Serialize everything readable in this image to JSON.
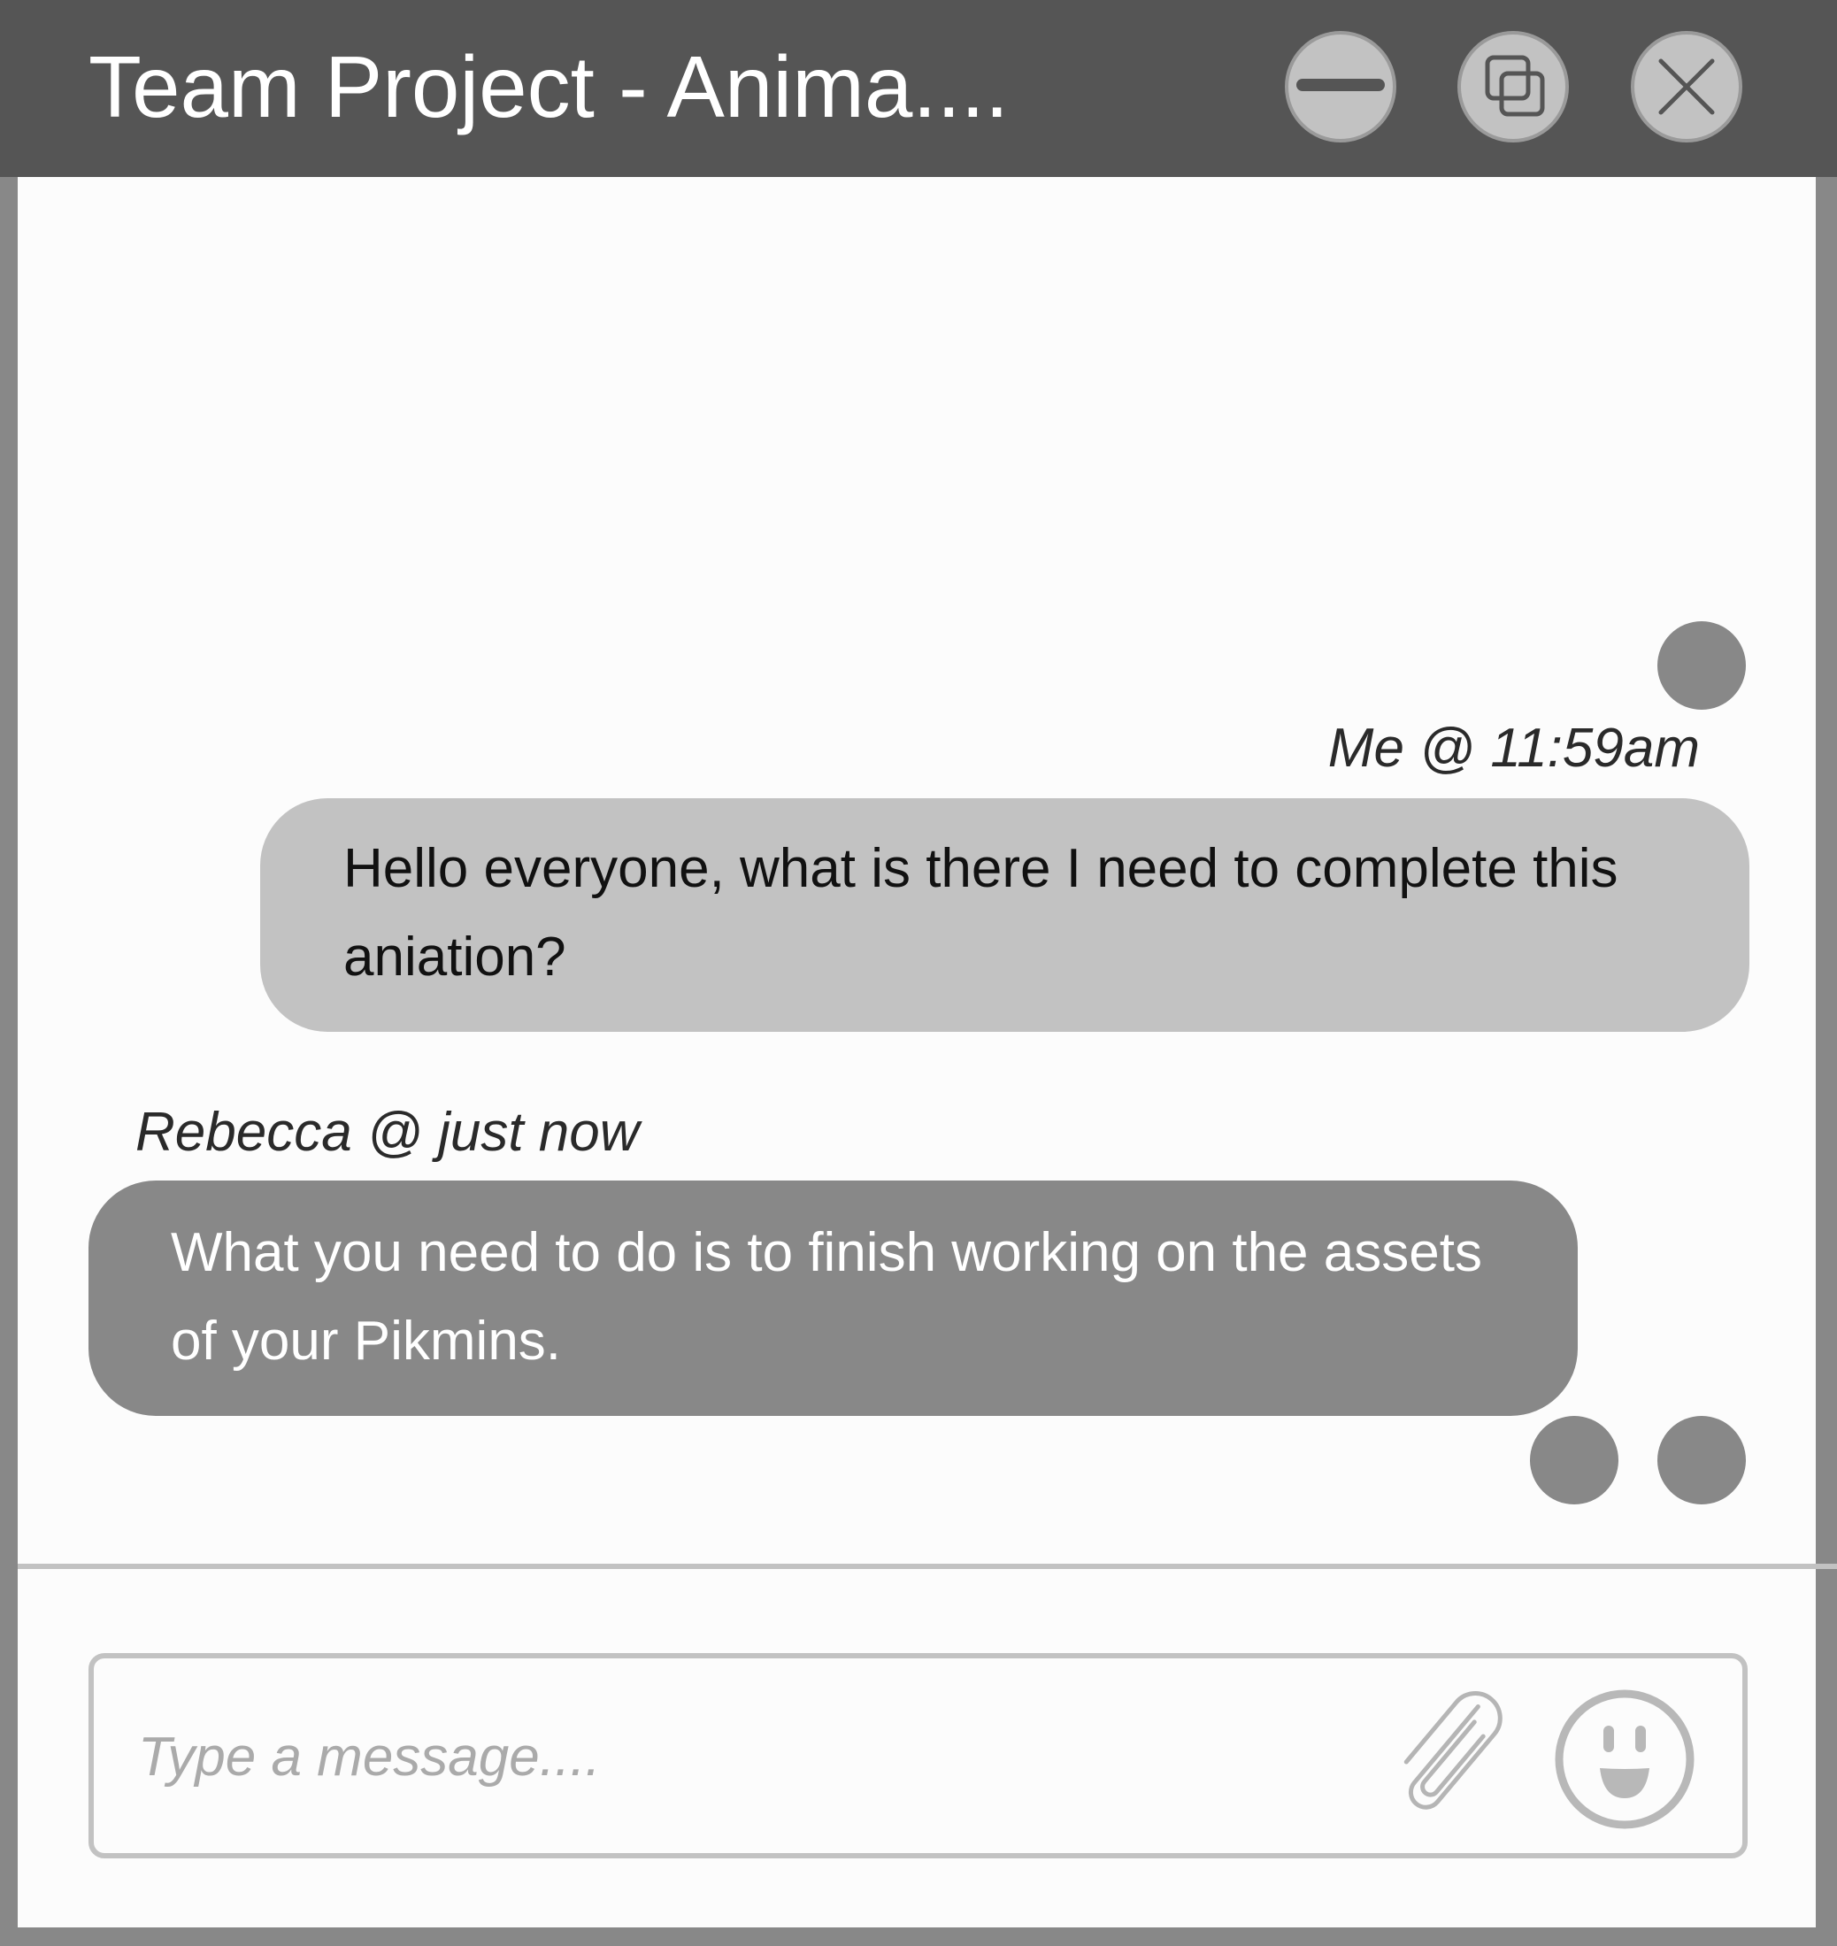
{
  "window": {
    "title": "Team Project - Anima....",
    "controls": [
      "minimize-icon",
      "restore-icon",
      "close-icon"
    ]
  },
  "messages": [
    {
      "sender_meta": "Me @ 11:59am",
      "text": "Hello everyone, what is there I need to complete this aniation?",
      "align": "right"
    },
    {
      "sender_meta": "Rebecca @ just now",
      "text": "What you need to do is to finish working on the assets of your Pikmins.",
      "align": "left"
    }
  ],
  "composer": {
    "placeholder": "Type a message....",
    "value": "",
    "icons": [
      "paperclip-icon",
      "emoji-icon"
    ]
  },
  "colors": {
    "titlebar": "#555555",
    "frame": "#888888",
    "bubble_me": "#c2c2c2",
    "bubble_other": "#888888",
    "avatar": "#888888",
    "border_light": "#c2c2c2"
  }
}
